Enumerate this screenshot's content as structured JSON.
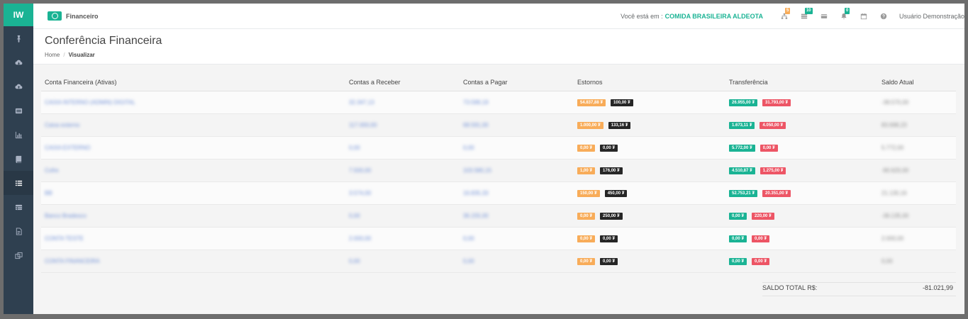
{
  "sidebar": {
    "logo": "IW",
    "items": [
      {
        "icon": "pin-icon"
      },
      {
        "icon": "cloud-download-icon"
      },
      {
        "icon": "cloud-upload-icon"
      },
      {
        "icon": "list-alt-icon"
      },
      {
        "icon": "bar-chart-icon"
      },
      {
        "icon": "book-icon"
      },
      {
        "icon": "list-icon",
        "active": true
      },
      {
        "icon": "table-icon"
      },
      {
        "icon": "file-text-icon"
      },
      {
        "icon": "clone-icon"
      }
    ]
  },
  "topbar": {
    "brand": "Financeiro",
    "location_label": "Você está em :",
    "location_value": "COMIDA BRASILEIRA ALDEOTA",
    "icons": [
      {
        "name": "sitemap-icon",
        "badge": "5",
        "badge_color": "#f8ac59"
      },
      {
        "name": "tasks-icon",
        "badge": "10",
        "badge_color": "#1ab394"
      },
      {
        "name": "credit-card-icon",
        "badge": "",
        "badge_color": ""
      },
      {
        "name": "bell-icon",
        "badge": "0",
        "badge_color": "#1ab394"
      },
      {
        "name": "calendar-icon",
        "badge": "",
        "badge_color": ""
      },
      {
        "name": "help-icon",
        "badge": "",
        "badge_color": ""
      }
    ],
    "user": "Usuário Demonstração"
  },
  "page": {
    "title": "Conferência Financeira",
    "breadcrumb_home": "Home",
    "breadcrumb_sep": "/",
    "breadcrumb_current": "Visualizar"
  },
  "table": {
    "headers": [
      "Conta Financeira (Ativas)",
      "Contas a Receber",
      "Contas a Pagar",
      "Estornos",
      "Transferência",
      "Saldo Atual"
    ],
    "rows": [
      {
        "conta": "CAIXA INTERNO (ADMIN) DIGITAL",
        "receber": "32.347,13",
        "pagar": "73.599,19",
        "est_a": "54.837,88 ₮",
        "est_b": "100,00 ₮",
        "tr_a": "26.955,00 ₮",
        "tr_b": "31.793,00 ₮",
        "saldo": "-38.570,00"
      },
      {
        "conta": "Caixa externo",
        "receber": "117.000,00",
        "pagar": "68.591,00",
        "est_a": "1.000,00 ₮",
        "est_b": "133,16 ₮",
        "tr_a": "1.673,11 ₮",
        "tr_b": "4.050,00 ₮",
        "saldo": "83.698,23"
      },
      {
        "conta": "CAIXA EXTERNO",
        "receber": "0,00",
        "pagar": "0,00",
        "est_a": "0,00 ₮",
        "est_b": "0,00 ₮",
        "tr_a": "5.772,00 ₮",
        "tr_b": "0,00 ₮",
        "saldo": "5.772,00"
      },
      {
        "conta": "Cofre",
        "receber": "7.500,00",
        "pagar": "103.580,15",
        "est_a": "1,00 ₮",
        "est_b": "176,00 ₮",
        "tr_a": "4.510,87 ₮",
        "tr_b": "1.275,00 ₮",
        "saldo": "-90.620,00"
      },
      {
        "conta": "BB",
        "receber": "3.574,00",
        "pagar": "16.835,33",
        "est_a": "150,00 ₮",
        "est_b": "450,00 ₮",
        "tr_a": "52.753,21 ₮",
        "tr_b": "20.351,00 ₮",
        "saldo": "21.130,16"
      },
      {
        "conta": "Banco Bradesco",
        "receber": "0,00",
        "pagar": "36.155,00",
        "est_a": "0,00 ₮",
        "est_b": "250,00 ₮",
        "tr_a": "0,00 ₮",
        "tr_b": "220,00 ₮",
        "saldo": "-36.135,00"
      },
      {
        "conta": "CONTA TESTE",
        "receber": "2.000,00",
        "pagar": "0,00",
        "est_a": "0,00 ₮",
        "est_b": "0,00 ₮",
        "tr_a": "0,00 ₮",
        "tr_b": "0,00 ₮",
        "saldo": "2.000,00"
      },
      {
        "conta": "CONTA FINANCEIRA",
        "receber": "0,00",
        "pagar": "0,00",
        "est_a": "0,00 ₮",
        "est_b": "0,00 ₮",
        "tr_a": "0,00 ₮",
        "tr_b": "0,00 ₮",
        "saldo": "0,00"
      }
    ]
  },
  "total": {
    "label": "SALDO TOTAL R$:",
    "value": "-81.021,99"
  }
}
